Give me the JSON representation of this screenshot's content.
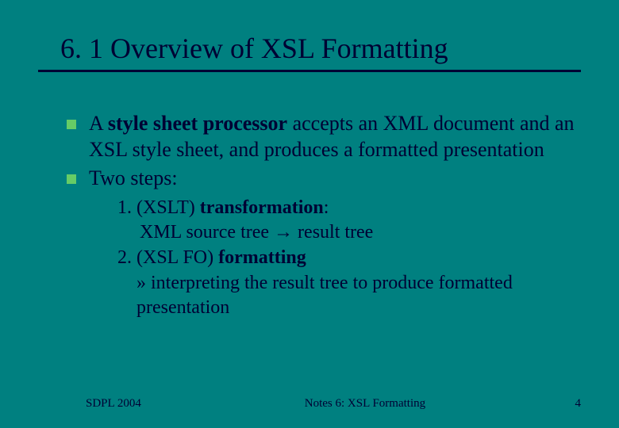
{
  "slide": {
    "title": "6. 1 Overview of XSL Formatting",
    "bullets": [
      {
        "prefix": "A ",
        "bold": "style sheet processor",
        "rest": " accepts an XML document and an XSL style sheet, and produces a formatted presentation"
      },
      {
        "prefix": "",
        "bold": "",
        "rest": "Two steps:"
      }
    ],
    "sub": {
      "line1_a": "1. (XSLT) ",
      "line1_b": "transformation",
      "line1_c": ":",
      "line2_a": "XML source tree ",
      "line2_arrow": "→",
      "line2_b": " result tree",
      "line3_a": "2. (XSL FO) ",
      "line3_b": "formatting",
      "line4": "» interpreting the  result tree to produce formatted presentation"
    },
    "footer": {
      "left": "SDPL 2004",
      "center": "Notes 6: XSL Formatting",
      "right": "4"
    }
  }
}
